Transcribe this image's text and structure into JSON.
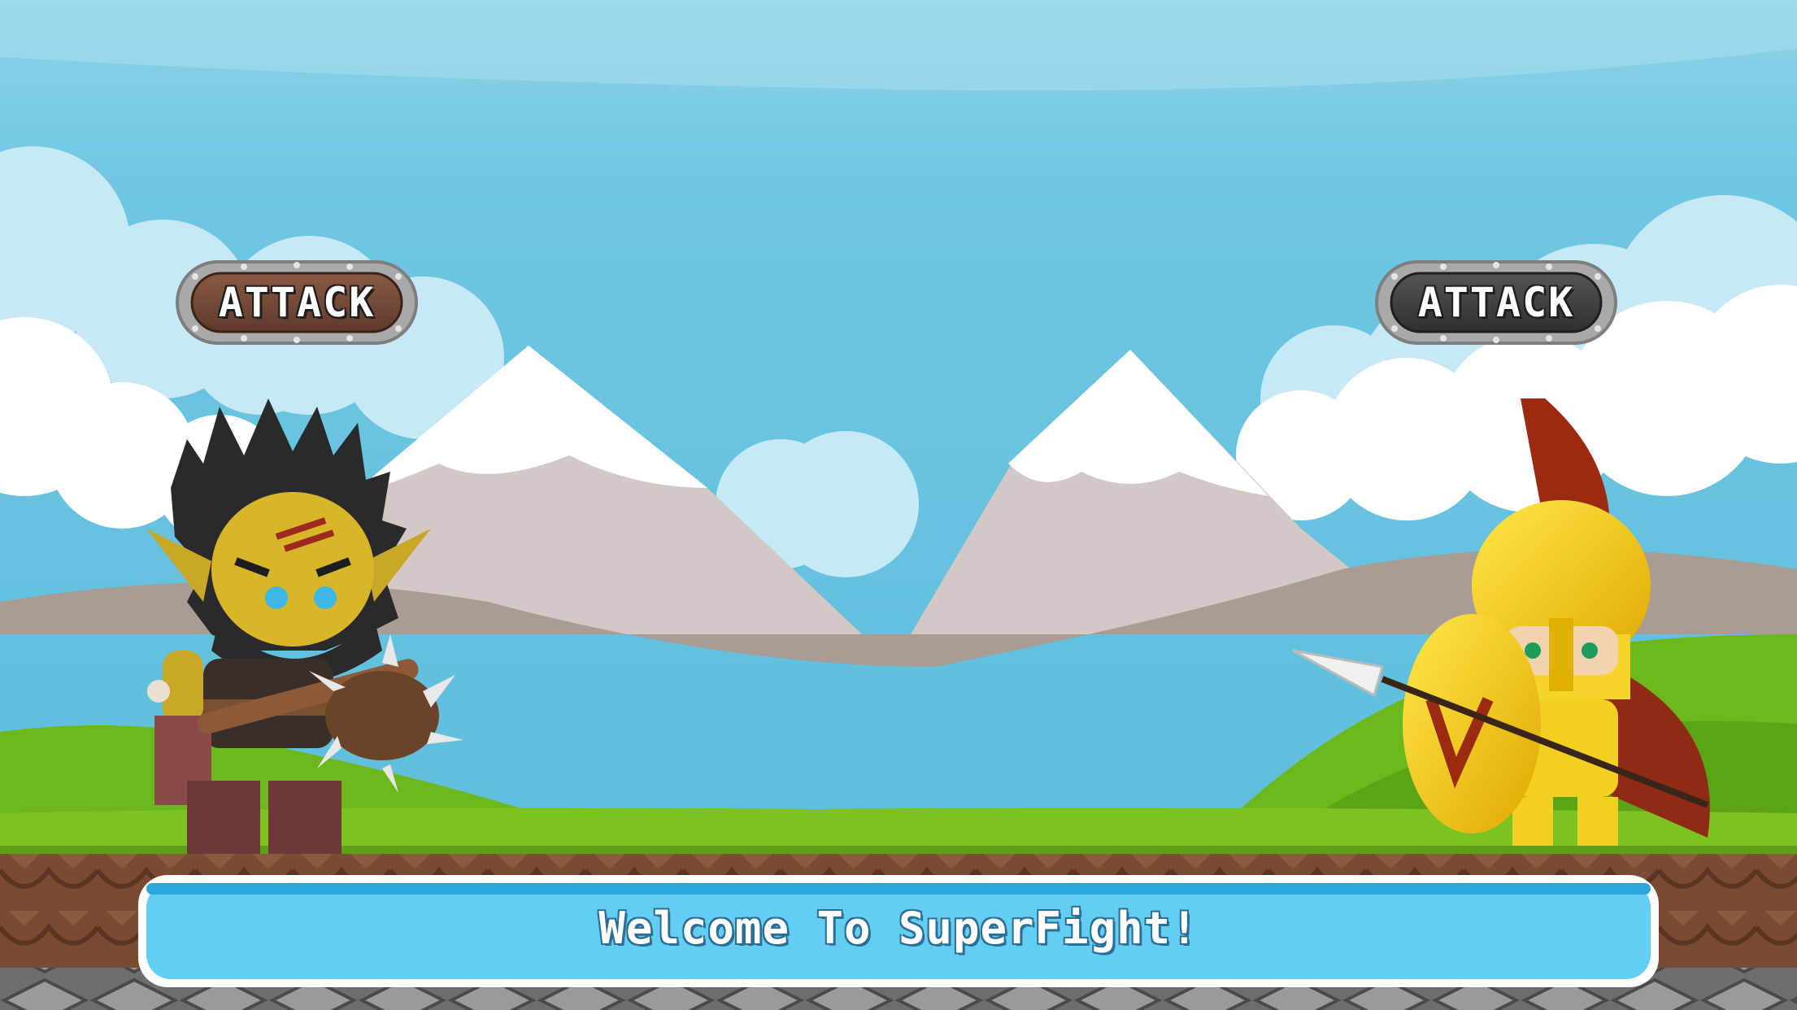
{
  "game": {
    "player_left": {
      "name": "orc-warrior",
      "attack_label": "ATTACK",
      "button_color": "#6b4536"
    },
    "player_right": {
      "name": "spartan-warrior",
      "attack_label": "ATTACK",
      "button_color": "#3f3f3f"
    },
    "message": "Welcome To SuperFight!"
  },
  "colors": {
    "sky": "#62c1dd",
    "mountain": "#a99d96",
    "grass": "#7cc321",
    "message_bg": "#64cdf2"
  }
}
